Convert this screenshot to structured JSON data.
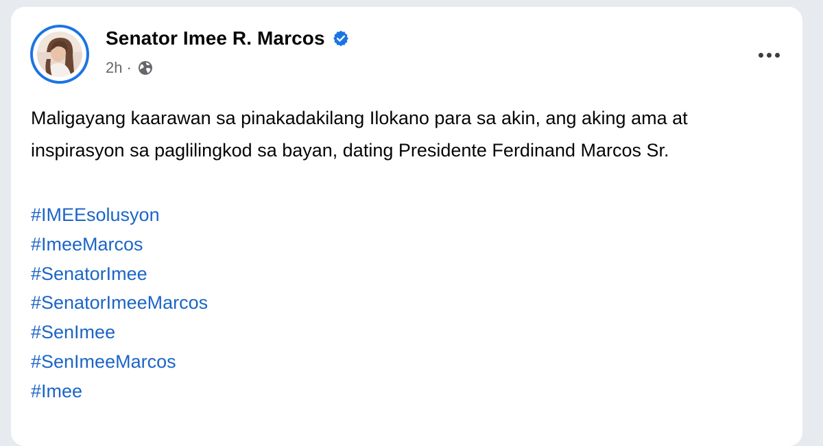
{
  "post": {
    "author": "Senator Imee R. Marcos",
    "verified": true,
    "timestamp": "2h",
    "separator": "·",
    "audience_icon": "globe-icon",
    "more_icon": "more-options-icon",
    "text": "Maligayang kaarawan sa pinakadakilang Ilokano para sa akin, ang aking ama at inspirasyon sa paglilingkod sa bayan, dating Presidente Ferdinand Marcos Sr.",
    "hashtags": [
      "#IMEEsolusyon",
      "#ImeeMarcos",
      "#SenatorImee",
      "#SenatorImeeMarcos",
      "#SenImee",
      "#SenImeeMarcos",
      "#Imee"
    ]
  },
  "colors": {
    "card_bg": "#ffffff",
    "page_bg": "#e7eaee",
    "accent_blue": "#1b74e4",
    "hashtag_blue": "#1b65c6",
    "meta_gray": "#65676b"
  }
}
